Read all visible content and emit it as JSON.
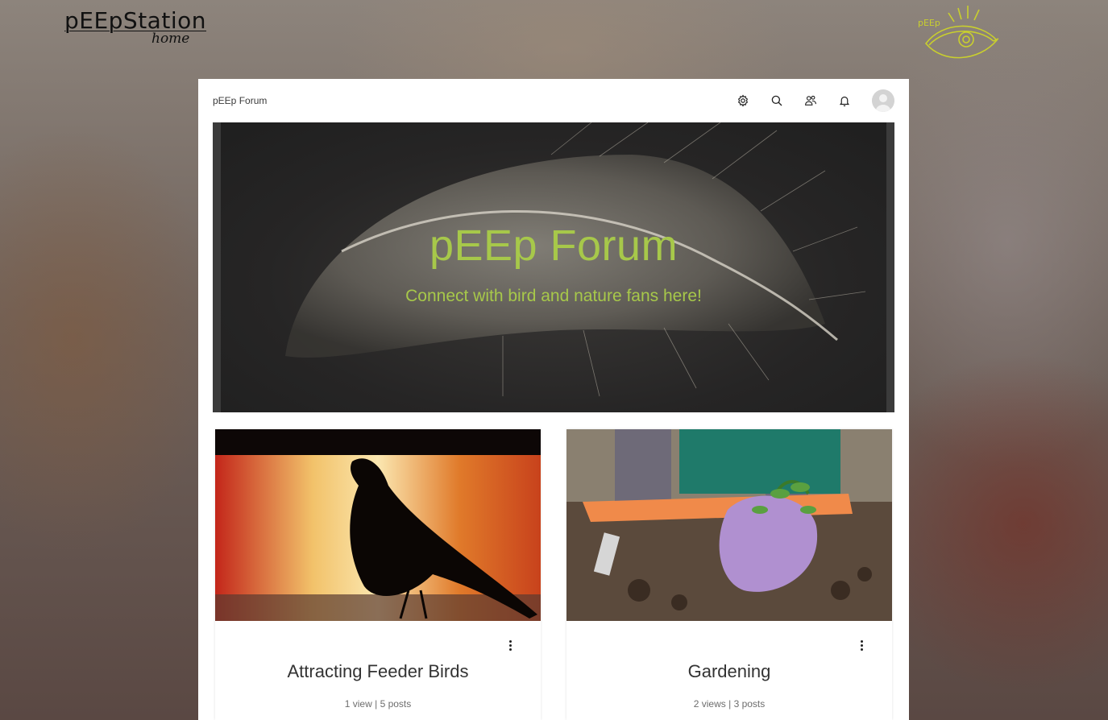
{
  "site": {
    "brand": "pEEpStation",
    "brand_sub": "home",
    "eye_logo_text": "pEEp"
  },
  "forum": {
    "breadcrumb": "pEEp Forum",
    "toolbar_icons": [
      "settings-icon",
      "search-icon",
      "members-icon",
      "notifications-icon",
      "profile-avatar"
    ]
  },
  "hero": {
    "title": "pEEp Forum",
    "subtitle": "Connect with bird and nature fans here!"
  },
  "categories": [
    {
      "title": "Attracting Feeder Birds",
      "views": "1 view",
      "separator": "|",
      "posts": "5 posts"
    },
    {
      "title": "Gardening",
      "views": "2 views",
      "separator": "|",
      "posts": "3 posts"
    }
  ],
  "colors": {
    "accent": "#a7c84a",
    "logo_yellow": "#c9cf2e"
  }
}
